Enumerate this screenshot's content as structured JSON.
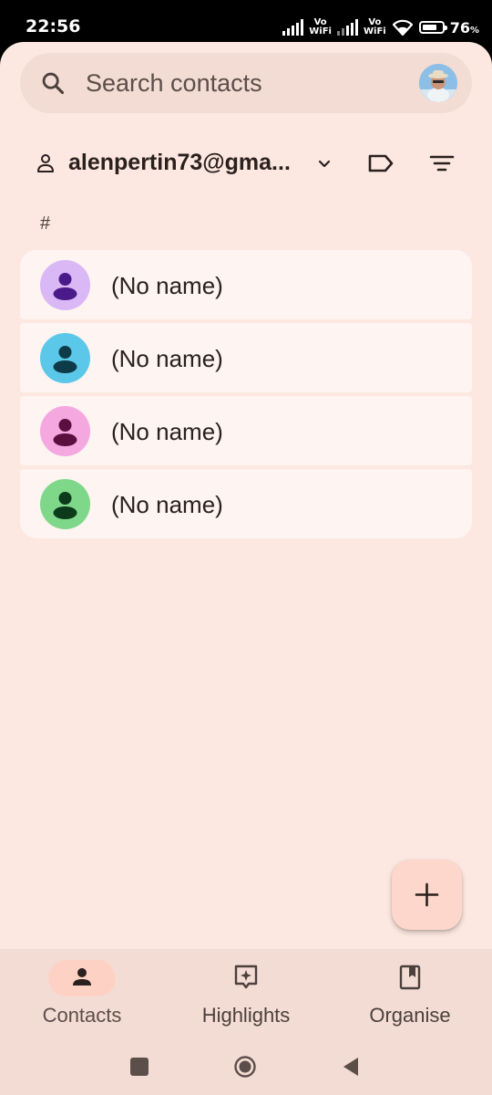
{
  "status_bar": {
    "time": "22:56",
    "sim1_label": "Vo\nWiFi",
    "sim2_label": "Vo\nWiFi",
    "battery_percent": "76",
    "battery_unit": "%",
    "battery_level": 0.76
  },
  "search": {
    "placeholder": "Search contacts",
    "icon": "search-icon"
  },
  "account": {
    "email": "alenpertin73@gma...",
    "icons": [
      "person-icon",
      "chevron-down-icon",
      "label-icon",
      "filter-icon"
    ]
  },
  "section_header": "#",
  "contacts": [
    {
      "name": "(No name)",
      "avatar_bg": "#d9b8f5",
      "avatar_fg": "#4a1a8a"
    },
    {
      "name": "(No name)",
      "avatar_bg": "#5bc8ea",
      "avatar_fg": "#0d3b48"
    },
    {
      "name": "(No name)",
      "avatar_bg": "#f5a8e0",
      "avatar_fg": "#5a0f3f"
    },
    {
      "name": "(No name)",
      "avatar_bg": "#7fd88a",
      "avatar_fg": "#0c3a1a"
    }
  ],
  "fab": {
    "icon": "plus-icon"
  },
  "bottom_nav": {
    "items": [
      {
        "label": "Contacts",
        "icon": "person-icon",
        "active": true
      },
      {
        "label": "Highlights",
        "icon": "sparkle-icon",
        "active": false
      },
      {
        "label": "Organise",
        "icon": "bookmark-icon",
        "active": false
      }
    ]
  },
  "colors": {
    "background": "#fde8e1",
    "surface": "#f3dcd4",
    "card": "#fef4f1",
    "fab": "#fdd7cc",
    "active_pill": "#fdd1c4"
  }
}
